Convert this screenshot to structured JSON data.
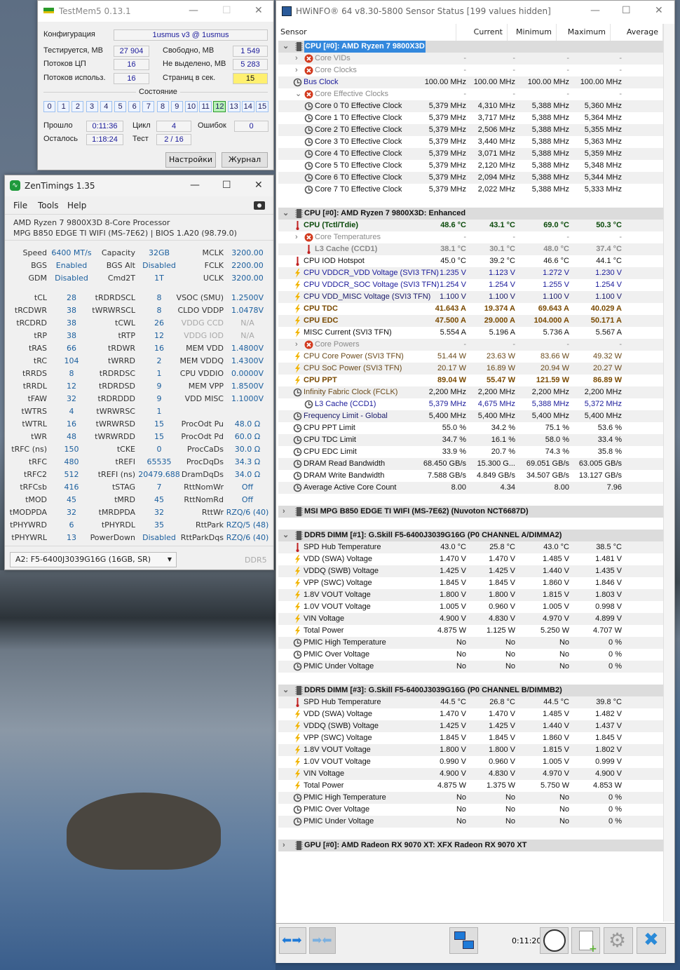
{
  "testmem5": {
    "title": "TestMem5  0.13.1",
    "config_label": "Конфигурация",
    "config_value": "1usmus v3 @ 1usmus",
    "tested_label": "Тестируется, MB",
    "tested_value": "27 904",
    "free_label": "Свободно, MB",
    "free_value": "1 549",
    "cpu_threads_label": "Потоков ЦП",
    "cpu_threads_value": "16",
    "unallocated_label": "Не выделено, MB",
    "unallocated_value": "5 283",
    "threads_used_label": "Потоков использ.",
    "threads_used_value": "16",
    "pages_label": "Страниц в сек.",
    "pages_value": "15",
    "state_label": "Состояние",
    "threads": [
      "0",
      "1",
      "2",
      "3",
      "4",
      "5",
      "6",
      "7",
      "8",
      "9",
      "10",
      "11",
      "12",
      "13",
      "14",
      "15"
    ],
    "active_thread": "12",
    "elapsed_label": "Прошло",
    "elapsed_value": "0:11:36",
    "cycle_label": "Цикл",
    "cycle_value": "4",
    "errors_label": "Ошибок",
    "errors_value": "0",
    "remaining_label": "Осталось",
    "remaining_value": "1:18:24",
    "test_label": "Тест",
    "test_value": "2 / 16",
    "settings_button": "Настройки",
    "log_button": "Журнал"
  },
  "zentimings": {
    "title": "ZenTimings 1.35",
    "menu": [
      "File",
      "Tools",
      "Help"
    ],
    "cpu": "AMD Ryzen 7 9800X3D 8-Core Processor",
    "board": "MPG B850 EDGE TI WIFI (MS-7E62) | BIOS 1.A20 (98.79.0)",
    "top": [
      [
        [
          "Speed",
          "6400 MT/s"
        ],
        [
          "Capacity",
          "32GB"
        ],
        [
          "MCLK",
          "3200.00"
        ]
      ],
      [
        [
          "BGS",
          "Enabled"
        ],
        [
          "BGS Alt",
          "Disabled"
        ],
        [
          "FCLK",
          "2200.00"
        ]
      ],
      [
        [
          "GDM",
          "Disabled"
        ],
        [
          "Cmd2T",
          "1T"
        ],
        [
          "UCLK",
          "3200.00"
        ]
      ]
    ],
    "timings": [
      [
        [
          "tCL",
          "28"
        ],
        [
          "tRDRDSCL",
          "8"
        ],
        [
          "VSOC (SMU)",
          "1.2500V"
        ]
      ],
      [
        [
          "tRCDWR",
          "38"
        ],
        [
          "tWRWRSCL",
          "8"
        ],
        [
          "CLDO VDDP",
          "1.0478V"
        ]
      ],
      [
        [
          "tRCDRD",
          "38"
        ],
        [
          "tCWL",
          "26"
        ],
        [
          "VDDG CCD",
          "N/A",
          true
        ]
      ],
      [
        [
          "tRP",
          "38"
        ],
        [
          "tRTP",
          "12"
        ],
        [
          "VDDG IOD",
          "N/A",
          true
        ]
      ],
      [
        [
          "tRAS",
          "66"
        ],
        [
          "tRDWR",
          "16"
        ],
        [
          "MEM VDD",
          "1.4800V"
        ]
      ],
      [
        [
          "tRC",
          "104"
        ],
        [
          "tWRRD",
          "2"
        ],
        [
          "MEM VDDQ",
          "1.4300V"
        ]
      ],
      [
        [
          "tRRDS",
          "8"
        ],
        [
          "tRDRDSC",
          "1"
        ],
        [
          "CPU VDDIO",
          "0.0000V"
        ]
      ],
      [
        [
          "tRRDL",
          "12"
        ],
        [
          "tRDRDSD",
          "9"
        ],
        [
          "MEM VPP",
          "1.8500V"
        ]
      ],
      [
        [
          "tFAW",
          "32"
        ],
        [
          "tRDRDDD",
          "9"
        ],
        [
          "VDD MISC",
          "1.1000V"
        ]
      ],
      [
        [
          "tWTRS",
          "4"
        ],
        [
          "tWRWRSC",
          "1"
        ],
        [
          "",
          ""
        ]
      ],
      [
        [
          "tWTRL",
          "16"
        ],
        [
          "tWRWRSD",
          "15"
        ],
        [
          "ProcOdt Pu",
          "48.0 Ω"
        ]
      ],
      [
        [
          "tWR",
          "48"
        ],
        [
          "tWRWRDD",
          "15"
        ],
        [
          "ProcOdt Pd",
          "60.0 Ω"
        ]
      ],
      [
        [
          "tRFC (ns)",
          "150"
        ],
        [
          "tCKE",
          "0"
        ],
        [
          "ProcCaDs",
          "30.0 Ω"
        ]
      ],
      [
        [
          "tRFC",
          "480"
        ],
        [
          "tREFI",
          "65535"
        ],
        [
          "ProcDqDs",
          "34.3 Ω"
        ]
      ],
      [
        [
          "tRFC2",
          "512"
        ],
        [
          "tREFI (ns)",
          "20479.688"
        ],
        [
          "DramDqDs",
          "34.0 Ω"
        ]
      ],
      [
        [
          "tRFCsb",
          "416"
        ],
        [
          "tSTAG",
          "7"
        ],
        [
          "RttNomWr",
          "Off"
        ]
      ],
      [
        [
          "tMOD",
          "45"
        ],
        [
          "tMRD",
          "45"
        ],
        [
          "RttNomRd",
          "Off"
        ]
      ],
      [
        [
          "tMODPDA",
          "32"
        ],
        [
          "tMRDPDA",
          "32"
        ],
        [
          "RttWr",
          "RZQ/6 (40)"
        ]
      ],
      [
        [
          "tPHYWRD",
          "6"
        ],
        [
          "tPHYRDL",
          "35"
        ],
        [
          "RttPark",
          "RZQ/5 (48)"
        ]
      ],
      [
        [
          "tPHYWRL",
          "13"
        ],
        [
          "PowerDown",
          "Disabled"
        ],
        [
          "RttParkDqs",
          "RZQ/6 (40)"
        ]
      ]
    ],
    "dimm_select": "A2: F5-6400J3039G16G (16GB, SR)",
    "mem_type": "DDR5"
  },
  "hwinfo": {
    "title": "HWiNFO® 64 v8.30-5800 Sensor Status [199 values hidden]",
    "columns": [
      "Sensor",
      "Current",
      "Minimum",
      "Maximum",
      "Average"
    ],
    "timer": "0:11:20",
    "colors": {
      "k": "#111111",
      "g": "#8a8a8a",
      "b": "#1a1a9a",
      "gr": "#0a4a0a",
      "br": "#7a4a00",
      "bw": "#6a4a1a",
      "bk": "#1a1a6a"
    },
    "rows": [
      {
        "t": "grp",
        "l": "CPU [#0]: AMD Ryzen 7 9800X3D",
        "e": "open",
        "sel": true
      },
      {
        "l": "Core VIDs",
        "i": "x",
        "d": 2,
        "e": "closed",
        "c": "g",
        "v": [
          "-",
          "-",
          "-",
          "-"
        ]
      },
      {
        "l": "Core Clocks",
        "i": "x",
        "d": 2,
        "e": "closed",
        "c": "g",
        "v": [
          "-",
          "-",
          "-",
          "-"
        ]
      },
      {
        "l": "Bus Clock",
        "i": "clock",
        "d": 1,
        "lc": "b",
        "v": [
          "100.00 MHz",
          "100.00 MHz",
          "100.00 MHz",
          "100.00 MHz"
        ]
      },
      {
        "l": "Core Effective Clocks",
        "i": "x",
        "d": 2,
        "e": "open",
        "c": "g",
        "v": [
          "-",
          "-",
          "-",
          "-"
        ]
      },
      {
        "l": "Core 0 T0 Effective Clock",
        "i": "clock",
        "d": 2,
        "v": [
          "5,379 MHz",
          "4,310 MHz",
          "5,388 MHz",
          "5,360 MHz"
        ]
      },
      {
        "l": "Core 1 T0 Effective Clock",
        "i": "clock",
        "d": 2,
        "v": [
          "5,379 MHz",
          "3,717 MHz",
          "5,388 MHz",
          "5,364 MHz"
        ]
      },
      {
        "l": "Core 2 T0 Effective Clock",
        "i": "clock",
        "d": 2,
        "v": [
          "5,379 MHz",
          "2,506 MHz",
          "5,388 MHz",
          "5,355 MHz"
        ]
      },
      {
        "l": "Core 3 T0 Effective Clock",
        "i": "clock",
        "d": 2,
        "v": [
          "5,379 MHz",
          "3,440 MHz",
          "5,388 MHz",
          "5,363 MHz"
        ]
      },
      {
        "l": "Core 4 T0 Effective Clock",
        "i": "clock",
        "d": 2,
        "v": [
          "5,379 MHz",
          "3,071 MHz",
          "5,388 MHz",
          "5,359 MHz"
        ]
      },
      {
        "l": "Core 5 T0 Effective Clock",
        "i": "clock",
        "d": 2,
        "v": [
          "5,379 MHz",
          "2,120 MHz",
          "5,388 MHz",
          "5,348 MHz"
        ]
      },
      {
        "l": "Core 6 T0 Effective Clock",
        "i": "clock",
        "d": 2,
        "v": [
          "5,379 MHz",
          "2,094 MHz",
          "5,388 MHz",
          "5,344 MHz"
        ]
      },
      {
        "l": "Core 7 T0 Effective Clock",
        "i": "clock",
        "d": 2,
        "v": [
          "5,379 MHz",
          "2,022 MHz",
          "5,388 MHz",
          "5,333 MHz"
        ]
      },
      {
        "t": "grp",
        "l": "CPU [#0]: AMD Ryzen 7 9800X3D: Enhanced",
        "e": "open"
      },
      {
        "l": "CPU (Tctl/Tdie)",
        "i": "thermo",
        "d": 1,
        "c": "gr",
        "bold": true,
        "v": [
          "48.6 °C",
          "43.1 °C",
          "69.0 °C",
          "50.3 °C"
        ]
      },
      {
        "l": "Core Temperatures",
        "i": "x",
        "d": 2,
        "e": "closed",
        "c": "g",
        "v": [
          "-",
          "-",
          "-",
          "-"
        ]
      },
      {
        "l": "L3 Cache (CCD1)",
        "i": "thermo",
        "d": 2,
        "c": "g",
        "bold": true,
        "v": [
          "38.1 °C",
          "30.1 °C",
          "48.0 °C",
          "37.4 °C"
        ]
      },
      {
        "l": "CPU IOD Hotspot",
        "i": "thermo",
        "d": 1,
        "v": [
          "45.0 °C",
          "39.2 °C",
          "46.6 °C",
          "44.1 °C"
        ]
      },
      {
        "l": "CPU VDDCR_VDD Voltage (SVI3 TFN)",
        "i": "bolt",
        "d": 1,
        "c": "b",
        "v": [
          "1.235 V",
          "1.123 V",
          "1.272 V",
          "1.230 V"
        ]
      },
      {
        "l": "CPU VDDCR_SOC Voltage (SVI3 TFN)",
        "i": "bolt",
        "d": 1,
        "c": "b",
        "v": [
          "1.254 V",
          "1.254 V",
          "1.255 V",
          "1.254 V"
        ]
      },
      {
        "l": "CPU VDD_MISC Voltage (SVI3 TFN)",
        "i": "bolt",
        "d": 1,
        "c": "bk",
        "v": [
          "1.100 V",
          "1.100 V",
          "1.100 V",
          "1.100 V"
        ]
      },
      {
        "l": "CPU TDC",
        "i": "bolt",
        "d": 1,
        "c": "br",
        "bold": true,
        "v": [
          "41.643 A",
          "19.374 A",
          "69.643 A",
          "40.029 A"
        ]
      },
      {
        "l": "CPU EDC",
        "i": "bolt",
        "d": 1,
        "c": "br",
        "bold": true,
        "v": [
          "47.500 A",
          "29.000 A",
          "104.000 A",
          "50.171 A"
        ]
      },
      {
        "l": "MISC Current (SVI3 TFN)",
        "i": "bolt",
        "d": 1,
        "v": [
          "5.554 A",
          "5.196 A",
          "5.736 A",
          "5.567 A"
        ]
      },
      {
        "l": "Core Powers",
        "i": "x",
        "d": 2,
        "e": "closed",
        "c": "g",
        "v": [
          "-",
          "-",
          "-",
          "-"
        ]
      },
      {
        "l": "CPU Core Power (SVI3 TFN)",
        "i": "bolt",
        "d": 1,
        "c": "bw",
        "v": [
          "51.44 W",
          "23.63 W",
          "83.66 W",
          "49.32 W"
        ]
      },
      {
        "l": "CPU SoC Power (SVI3 TFN)",
        "i": "bolt",
        "d": 1,
        "c": "bw",
        "v": [
          "20.17 W",
          "16.89 W",
          "20.94 W",
          "20.27 W"
        ]
      },
      {
        "l": "CPU PPT",
        "i": "bolt",
        "d": 1,
        "c": "br",
        "bold": true,
        "v": [
          "89.04 W",
          "55.47 W",
          "121.59 W",
          "86.89 W"
        ]
      },
      {
        "l": "Infinity Fabric Clock (FCLK)",
        "i": "clock",
        "d": 1,
        "lc": "bw",
        "v": [
          "2,200 MHz",
          "2,200 MHz",
          "2,200 MHz",
          "2,200 MHz"
        ]
      },
      {
        "l": "L3 Cache (CCD1)",
        "i": "clock",
        "d": 2,
        "c": "b",
        "v": [
          "5,379 MHz",
          "4,675 MHz",
          "5,388 MHz",
          "5,372 MHz"
        ]
      },
      {
        "l": "Frequency Limit - Global",
        "i": "clock",
        "d": 1,
        "lc": "bk",
        "v": [
          "5,400 MHz",
          "5,400 MHz",
          "5,400 MHz",
          "5,400 MHz"
        ]
      },
      {
        "l": "CPU PPT Limit",
        "i": "clock",
        "d": 1,
        "v": [
          "55.0 %",
          "34.2 %",
          "75.1 %",
          "53.6 %"
        ]
      },
      {
        "l": "CPU TDC Limit",
        "i": "clock",
        "d": 1,
        "v": [
          "34.7 %",
          "16.1 %",
          "58.0 %",
          "33.4 %"
        ]
      },
      {
        "l": "CPU EDC Limit",
        "i": "clock",
        "d": 1,
        "v": [
          "33.9 %",
          "20.7 %",
          "74.3 %",
          "35.8 %"
        ]
      },
      {
        "l": "DRAM Read Bandwidth",
        "i": "clock",
        "d": 1,
        "v": [
          "68.450 GB/s",
          "15.300 G...",
          "69.051 GB/s",
          "63.005 GB/s"
        ]
      },
      {
        "l": "DRAM Write Bandwidth",
        "i": "clock",
        "d": 1,
        "v": [
          "7.588 GB/s",
          "4.849 GB/s",
          "34.507 GB/s",
          "13.127 GB/s"
        ]
      },
      {
        "l": "Average Active Core Count",
        "i": "clock",
        "d": 1,
        "v": [
          "8.00",
          "4.34",
          "8.00",
          "7.96"
        ]
      },
      {
        "t": "grp",
        "l": "MSI MPG B850 EDGE TI WIFI (MS-7E62) (Nuvoton NCT6687D)",
        "e": "closed"
      },
      {
        "t": "grp",
        "l": "DDR5 DIMM [#1]: G.Skill F5-6400J3039G16G (P0 CHANNEL A/DIMMA2)",
        "e": "open"
      },
      {
        "l": "SPD Hub Temperature",
        "i": "thermo",
        "d": 1,
        "v": [
          "43.0 °C",
          "25.8 °C",
          "43.0 °C",
          "38.5 °C"
        ]
      },
      {
        "l": "VDD (SWA) Voltage",
        "i": "bolt",
        "d": 1,
        "v": [
          "1.470 V",
          "1.470 V",
          "1.485 V",
          "1.481 V"
        ]
      },
      {
        "l": "VDDQ (SWB) Voltage",
        "i": "bolt",
        "d": 1,
        "v": [
          "1.425 V",
          "1.425 V",
          "1.440 V",
          "1.435 V"
        ]
      },
      {
        "l": "VPP (SWC) Voltage",
        "i": "bolt",
        "d": 1,
        "v": [
          "1.845 V",
          "1.845 V",
          "1.860 V",
          "1.846 V"
        ]
      },
      {
        "l": "1.8V VOUT Voltage",
        "i": "bolt",
        "d": 1,
        "v": [
          "1.800 V",
          "1.800 V",
          "1.815 V",
          "1.803 V"
        ]
      },
      {
        "l": "1.0V VOUT Voltage",
        "i": "bolt",
        "d": 1,
        "v": [
          "1.005 V",
          "0.960 V",
          "1.005 V",
          "0.998 V"
        ]
      },
      {
        "l": "VIN Voltage",
        "i": "bolt",
        "d": 1,
        "v": [
          "4.900 V",
          "4.830 V",
          "4.970 V",
          "4.899 V"
        ]
      },
      {
        "l": "Total Power",
        "i": "bolt",
        "d": 1,
        "v": [
          "4.875 W",
          "1.125 W",
          "5.250 W",
          "4.707 W"
        ]
      },
      {
        "l": "PMIC High Temperature",
        "i": "clock",
        "d": 1,
        "v": [
          "No",
          "No",
          "No",
          "0 %"
        ]
      },
      {
        "l": "PMIC Over Voltage",
        "i": "clock",
        "d": 1,
        "v": [
          "No",
          "No",
          "No",
          "0 %"
        ]
      },
      {
        "l": "PMIC Under Voltage",
        "i": "clock",
        "d": 1,
        "v": [
          "No",
          "No",
          "No",
          "0 %"
        ]
      },
      {
        "t": "grp",
        "l": "DDR5 DIMM [#3]: G.Skill F5-6400J3039G16G (P0 CHANNEL B/DIMMB2)",
        "e": "open"
      },
      {
        "l": "SPD Hub Temperature",
        "i": "thermo",
        "d": 1,
        "v": [
          "44.5 °C",
          "26.8 °C",
          "44.5 °C",
          "39.8 °C"
        ]
      },
      {
        "l": "VDD (SWA) Voltage",
        "i": "bolt",
        "d": 1,
        "v": [
          "1.470 V",
          "1.470 V",
          "1.485 V",
          "1.482 V"
        ]
      },
      {
        "l": "VDDQ (SWB) Voltage",
        "i": "bolt",
        "d": 1,
        "v": [
          "1.425 V",
          "1.425 V",
          "1.440 V",
          "1.437 V"
        ]
      },
      {
        "l": "VPP (SWC) Voltage",
        "i": "bolt",
        "d": 1,
        "v": [
          "1.845 V",
          "1.845 V",
          "1.860 V",
          "1.845 V"
        ]
      },
      {
        "l": "1.8V VOUT Voltage",
        "i": "bolt",
        "d": 1,
        "v": [
          "1.800 V",
          "1.800 V",
          "1.815 V",
          "1.802 V"
        ]
      },
      {
        "l": "1.0V VOUT Voltage",
        "i": "bolt",
        "d": 1,
        "v": [
          "0.990 V",
          "0.960 V",
          "1.005 V",
          "0.999 V"
        ]
      },
      {
        "l": "VIN Voltage",
        "i": "bolt",
        "d": 1,
        "v": [
          "4.900 V",
          "4.830 V",
          "4.970 V",
          "4.900 V"
        ]
      },
      {
        "l": "Total Power",
        "i": "bolt",
        "d": 1,
        "v": [
          "4.875 W",
          "1.375 W",
          "5.750 W",
          "4.853 W"
        ]
      },
      {
        "l": "PMIC High Temperature",
        "i": "clock",
        "d": 1,
        "v": [
          "No",
          "No",
          "No",
          "0 %"
        ]
      },
      {
        "l": "PMIC Over Voltage",
        "i": "clock",
        "d": 1,
        "v": [
          "No",
          "No",
          "No",
          "0 %"
        ]
      },
      {
        "l": "PMIC Under Voltage",
        "i": "clock",
        "d": 1,
        "v": [
          "No",
          "No",
          "No",
          "0 %"
        ]
      },
      {
        "t": "grp",
        "l": "GPU [#0]: AMD Radeon RX 9070 XT: XFX Radeon RX 9070 XT",
        "e": "closed"
      }
    ]
  }
}
